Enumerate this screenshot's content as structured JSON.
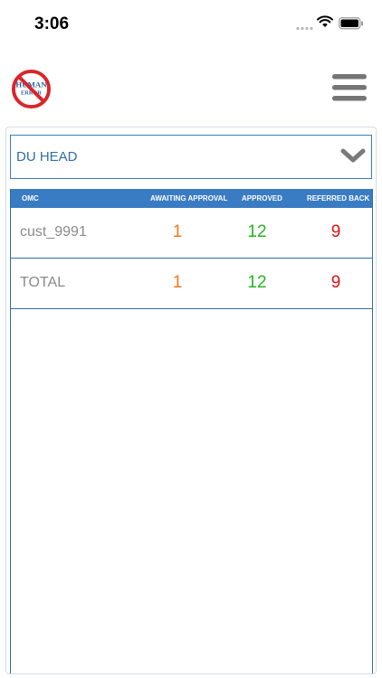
{
  "status_bar": {
    "time": "3:06"
  },
  "logo": {
    "text_line1": "HUMAN",
    "text_line2": "ERROR"
  },
  "dropdown": {
    "selected": "DU HEAD"
  },
  "table": {
    "headers": {
      "omc": "OMC",
      "awaiting": "AWAITING APPROVAL",
      "approved": "APPROVED",
      "referred": "REFERRED BACK"
    },
    "rows": [
      {
        "name": "cust_9991",
        "awaiting": "1",
        "approved": "12",
        "referred": "9"
      },
      {
        "name": "TOTAL",
        "awaiting": "1",
        "approved": "12",
        "referred": "9"
      }
    ]
  },
  "colors": {
    "accent": "#3a7cc3",
    "awaiting": "#f07a1e",
    "approved": "#27b322",
    "referred": "#e01010"
  }
}
